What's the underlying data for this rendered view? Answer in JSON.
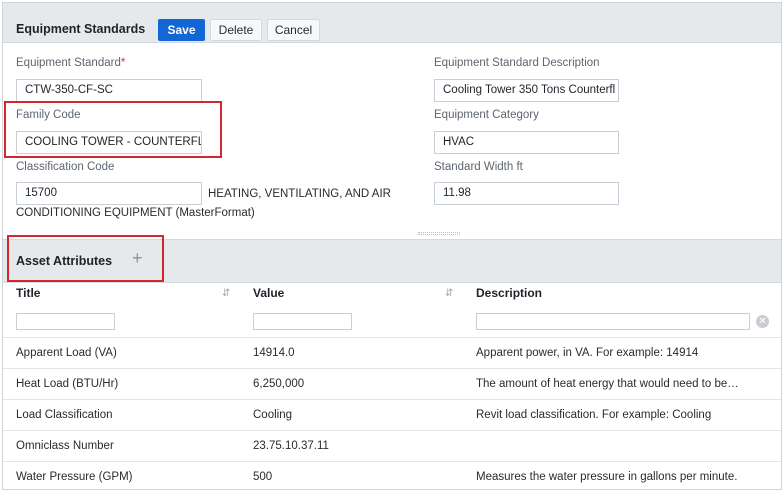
{
  "header": {
    "title": "Equipment Standards",
    "save_label": "Save",
    "delete_label": "Delete",
    "cancel_label": "Cancel"
  },
  "form": {
    "equipment_standard": {
      "label": "Equipment Standard",
      "required_mark": "*",
      "value": "CTW-350-CF-SC"
    },
    "equipment_standard_description": {
      "label": "Equipment Standard Description",
      "value": "Cooling Tower 350 Tons Counterfl"
    },
    "family_code": {
      "label": "Family Code",
      "value": "COOLING TOWER - COUNTERFLOW"
    },
    "equipment_category": {
      "label": "Equipment Category",
      "value": "HVAC"
    },
    "classification_code": {
      "label": "Classification Code",
      "value": "15700",
      "description_line1": "HEATING, VENTILATING, AND AIR",
      "description_line2": "CONDITIONING EQUIPMENT (MasterFormat)"
    },
    "standard_width": {
      "label": "Standard Width ft",
      "value": "11.98"
    }
  },
  "asset_attributes": {
    "title": "Asset Attributes",
    "add_icon": "plus-icon",
    "columns": [
      "Title",
      "Value",
      "Description"
    ],
    "rows": [
      {
        "title": "Apparent Load (VA)",
        "value": "14914.0",
        "description": "Apparent power, in VA. For example: 14914"
      },
      {
        "title": "Heat Load (BTU/Hr)",
        "value": "6,250,000",
        "description": "The amount of heat energy that would need to be…"
      },
      {
        "title": "Load Classification",
        "value": "Cooling",
        "description": "Revit load classification. For example: Cooling"
      },
      {
        "title": "Omniclass Number",
        "value": "23.75.10.37.11",
        "description": ""
      },
      {
        "title": "Water Pressure (GPM)",
        "value": "500",
        "description": "Measures the water pressure in gallons per minute."
      }
    ]
  },
  "colors": {
    "primary": "#1266d6",
    "highlight": "#d3272f",
    "header_bg": "#e6e9ec"
  }
}
